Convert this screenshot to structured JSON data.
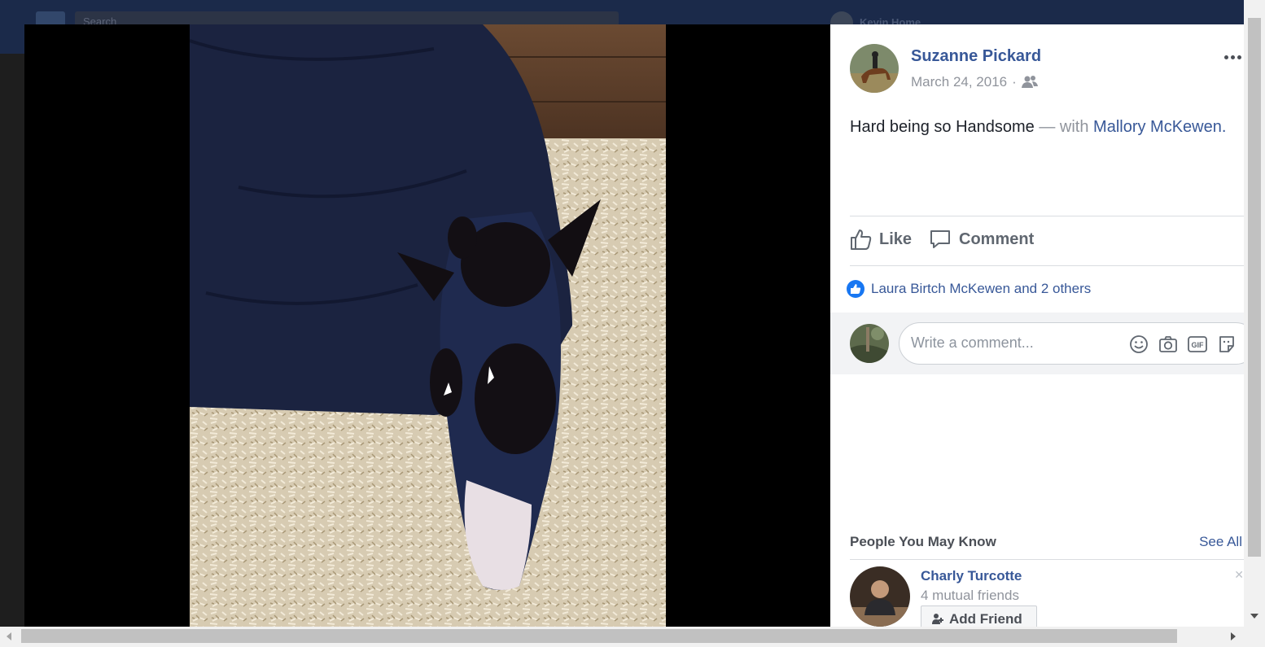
{
  "background": {
    "search_placeholder": "Search",
    "user_label": "Kevin    Home"
  },
  "post": {
    "author": "Suzanne Pickard",
    "date": "March 24, 2016",
    "date_separator": "·",
    "audience_icon": "friends-icon",
    "text": "Hard being so Handsome",
    "with_label": " — with ",
    "tagged": "Mallory McKewen."
  },
  "actions": {
    "like_label": "Like",
    "comment_label": "Comment"
  },
  "reactions": {
    "summary": "Laura Birtch McKewen and 2 others"
  },
  "comment": {
    "placeholder": "Write a comment...",
    "icons": [
      "emoji-icon",
      "camera-icon",
      "gif-icon",
      "sticker-icon"
    ]
  },
  "people_you_may_know": {
    "title": "People You May Know",
    "see_all": "See All",
    "person": {
      "name": "Charly Turcotte",
      "mutual": "4 mutual friends",
      "button": "Add Friend"
    }
  },
  "colors": {
    "link": "#385898",
    "like_badge": "#1877f2",
    "muted": "#90949c"
  }
}
